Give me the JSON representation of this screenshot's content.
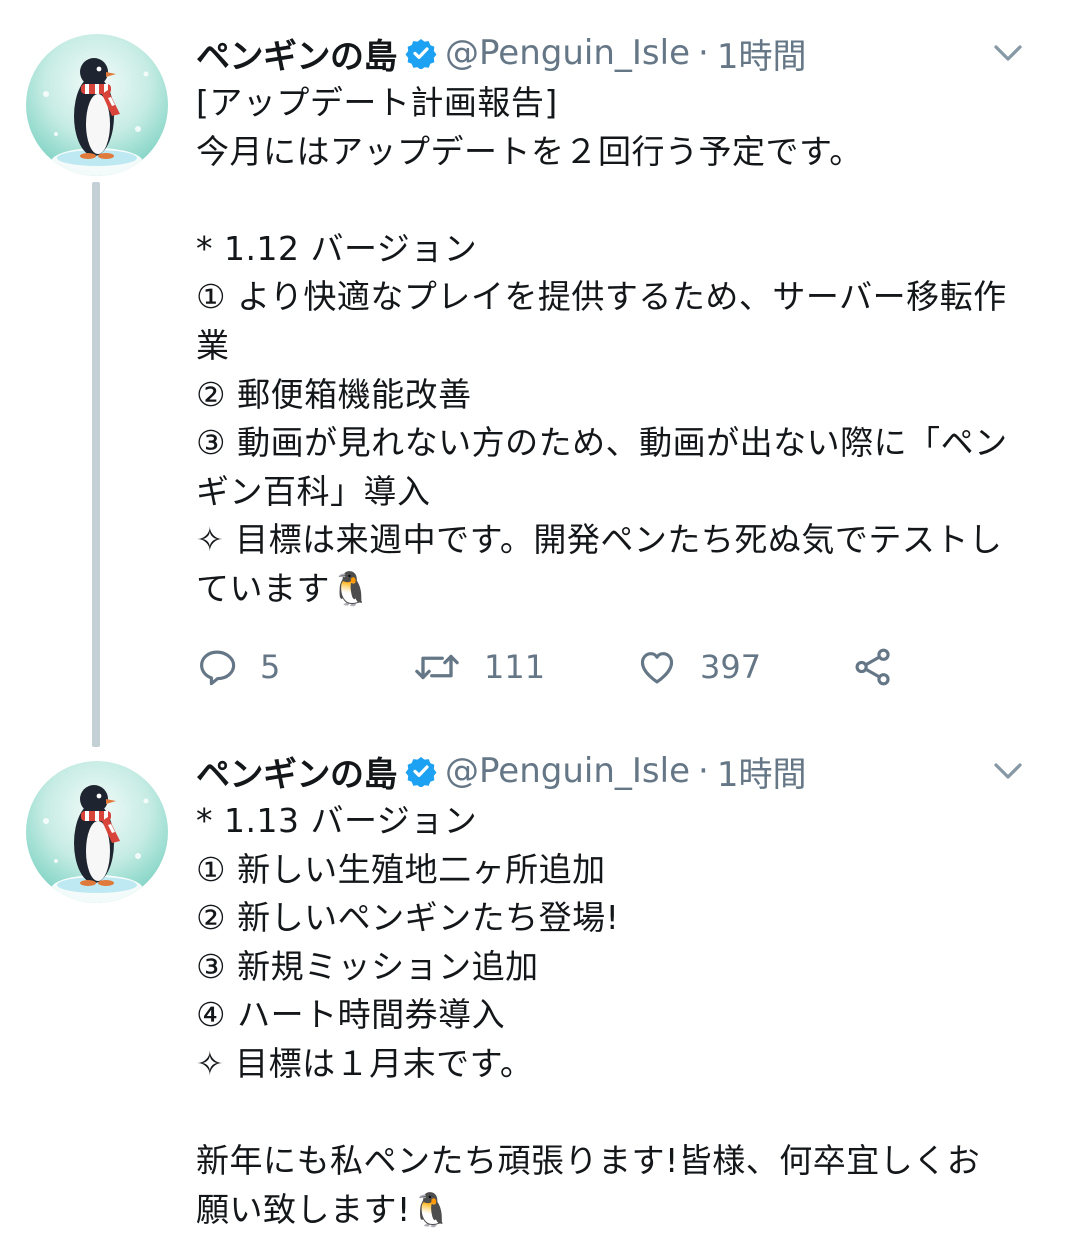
{
  "accent_color": "#1da1f2",
  "secondary_text_color": "#657786",
  "tweets": [
    {
      "author": {
        "display_name": "ペンギンの島",
        "handle": "@Penguin_Isle",
        "verified": true,
        "avatar": "penguin-avatar"
      },
      "separator": "·",
      "time": "1時間",
      "lines": [
        "[アップデート計画報告]",
        "今月にはアップデートを２回行う予定です。",
        "",
        "* 1.12 バージョン",
        "① より快適なプレイを提供するため、サーバー移転作",
        "業",
        "② 郵便箱機能改善",
        "③ 動画が見れない方のため、動画が出ない際に「ペン",
        "ギン百科」導入",
        "✧ 目標は来週中です。開発ペンたち死ぬ気でテストし",
        "ています🐧"
      ],
      "actions": {
        "replies": "5",
        "retweets": "111",
        "likes": "397"
      }
    },
    {
      "author": {
        "display_name": "ペンギンの島",
        "handle": "@Penguin_Isle",
        "verified": true,
        "avatar": "penguin-avatar"
      },
      "separator": "·",
      "time": "1時間",
      "lines": [
        "* 1.13 バージョン",
        "① 新しい生殖地二ヶ所追加",
        "② 新しいペンギンたち登場!",
        "③ 新規ミッション追加",
        "④ ハート時間券導入",
        "✧ 目標は１月末です。",
        "",
        "新年にも私ペンたち頑張ります!皆様、何卒宜しくお",
        "願い致します!🐧"
      ]
    }
  ]
}
